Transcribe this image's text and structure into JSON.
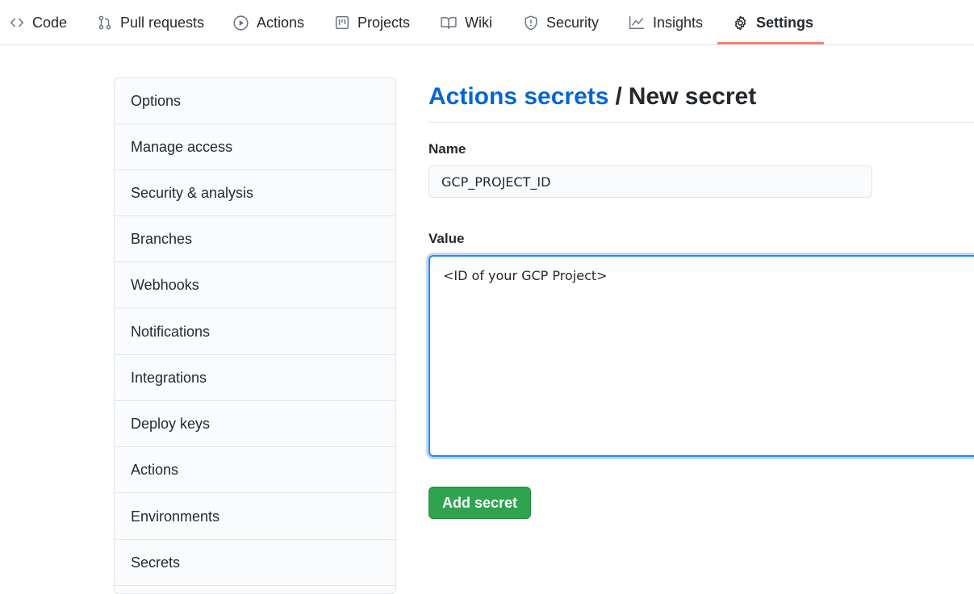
{
  "nav": {
    "tabs": [
      {
        "label": "Code",
        "icon": "code-icon"
      },
      {
        "label": "Pull requests",
        "icon": "git-pull-request-icon"
      },
      {
        "label": "Actions",
        "icon": "play-circle-icon"
      },
      {
        "label": "Projects",
        "icon": "project-board-icon"
      },
      {
        "label": "Wiki",
        "icon": "book-icon"
      },
      {
        "label": "Security",
        "icon": "shield-icon"
      },
      {
        "label": "Insights",
        "icon": "graph-icon"
      },
      {
        "label": "Settings",
        "icon": "gear-icon"
      }
    ],
    "selected": "Settings",
    "accent_color": "#f9826c"
  },
  "sidebar": {
    "items": [
      {
        "label": "Options"
      },
      {
        "label": "Manage access"
      },
      {
        "label": "Security & analysis"
      },
      {
        "label": "Branches"
      },
      {
        "label": "Webhooks"
      },
      {
        "label": "Notifications"
      },
      {
        "label": "Integrations"
      },
      {
        "label": "Deploy keys"
      },
      {
        "label": "Actions"
      },
      {
        "label": "Environments"
      },
      {
        "label": "Secrets"
      }
    ]
  },
  "main": {
    "breadcrumb_link": "Actions secrets",
    "breadcrumb_separator": "/",
    "page_title": "New secret",
    "name_label": "Name",
    "name_value": "GCP_PROJECT_ID",
    "value_label": "Value",
    "value_text": "<ID of your GCP Project>",
    "submit_label": "Add secret",
    "submit_color": "#2ea44f",
    "link_color": "#0366d6"
  }
}
